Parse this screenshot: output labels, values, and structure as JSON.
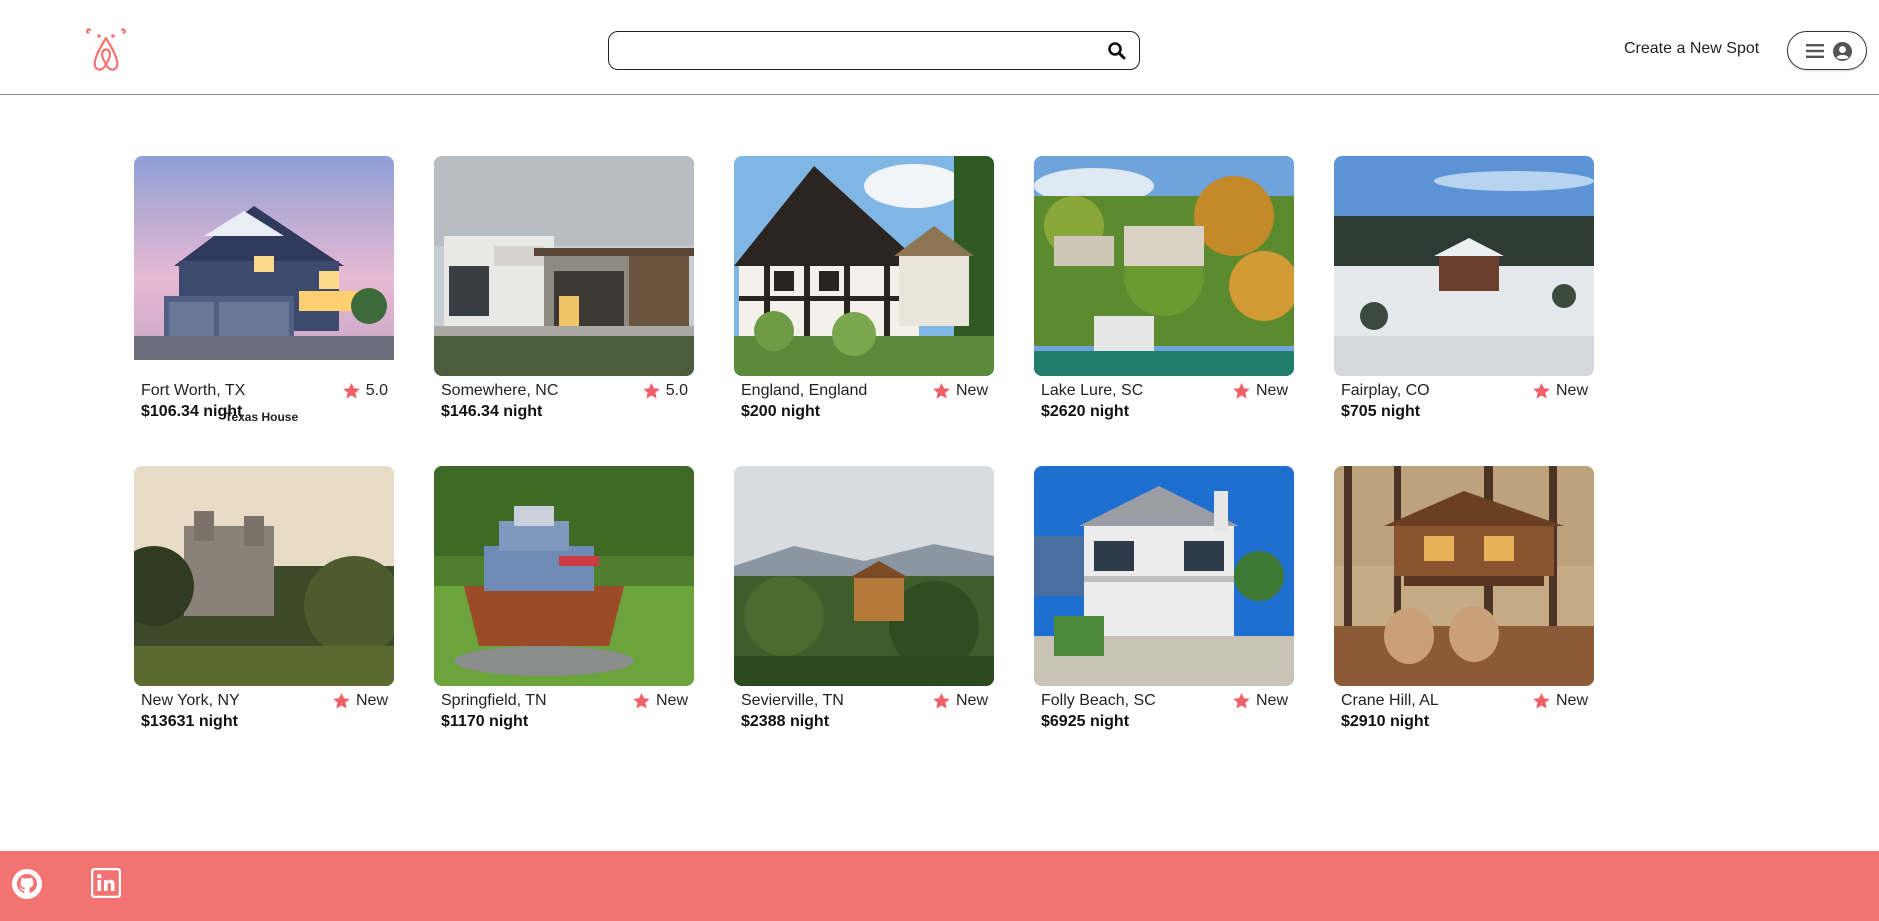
{
  "header": {
    "logo_icon": "airbnb-bear-logo-icon",
    "search": {
      "value": "",
      "placeholder": "",
      "icon": "search-icon"
    },
    "create_link": "Create a New Spot",
    "menu": {
      "icons": [
        "hamburger-menu-icon",
        "user-circle-icon"
      ]
    }
  },
  "accent_color": "#f37373",
  "star_color": "#f06069",
  "spots": [
    {
      "location": "Fort Worth, TX",
      "rating": "5.0",
      "price": "$106.34 night",
      "tooltip": "Texas House",
      "palette": "house"
    },
    {
      "location": "Somewhere, NC",
      "rating": "5.0",
      "price": "$146.34 night",
      "palette": "modern"
    },
    {
      "location": "England, England",
      "rating": "New",
      "price": "$200 night",
      "palette": "tudor"
    },
    {
      "location": "Lake Lure, SC",
      "rating": "New",
      "price": "$2620 night",
      "palette": "lake"
    },
    {
      "location": "Fairplay, CO",
      "rating": "New",
      "price": "$705 night",
      "palette": "snow"
    },
    {
      "location": "New York, NY",
      "rating": "New",
      "price": "$13631 night",
      "palette": "castle"
    },
    {
      "location": "Springfield, TN",
      "rating": "New",
      "price": "$1170 night",
      "palette": "ark"
    },
    {
      "location": "Sevierville, TN",
      "rating": "New",
      "price": "$2388 night",
      "palette": "mountain"
    },
    {
      "location": "Folly Beach, SC",
      "rating": "New",
      "price": "$6925 night",
      "palette": "beach"
    },
    {
      "location": "Crane Hill, AL",
      "rating": "New",
      "price": "$2910 night",
      "palette": "treehouse"
    }
  ],
  "footer": {
    "icons": [
      "github-icon",
      "linkedin-icon"
    ]
  }
}
